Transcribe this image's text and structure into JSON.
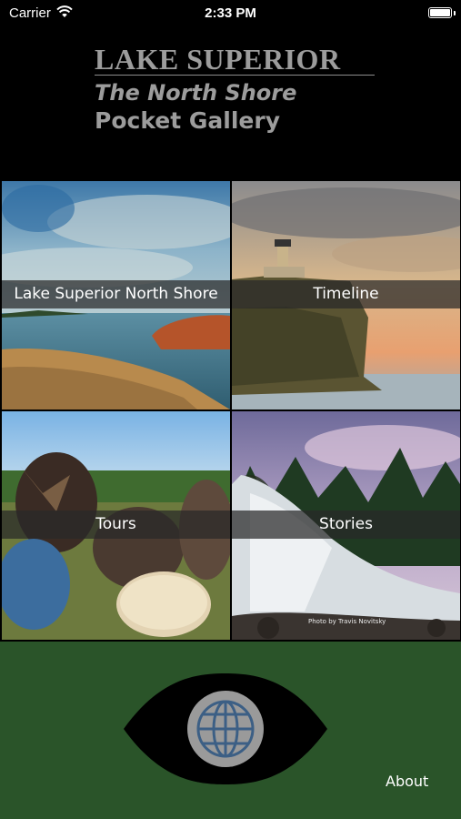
{
  "status_bar": {
    "carrier": "Carrier",
    "time": "2:33 PM",
    "wifi_icon": "wifi-icon",
    "battery_icon": "battery-icon"
  },
  "header": {
    "title_line1": "LAKE SUPERIOR",
    "title_line2": "The North Shore",
    "title_line3": "Pocket Gallery"
  },
  "tiles": [
    {
      "label": "Lake Superior North Shore"
    },
    {
      "label": "Timeline"
    },
    {
      "label": "Tours"
    },
    {
      "label": "Stories",
      "photo_credit": "Photo by Travis Novitsky"
    }
  ],
  "footer": {
    "about_label": "About",
    "globe_icon": "globe-icon",
    "colors": {
      "background": "#2a5429",
      "eye": "#000000",
      "globe": "#9a9a9a"
    }
  }
}
